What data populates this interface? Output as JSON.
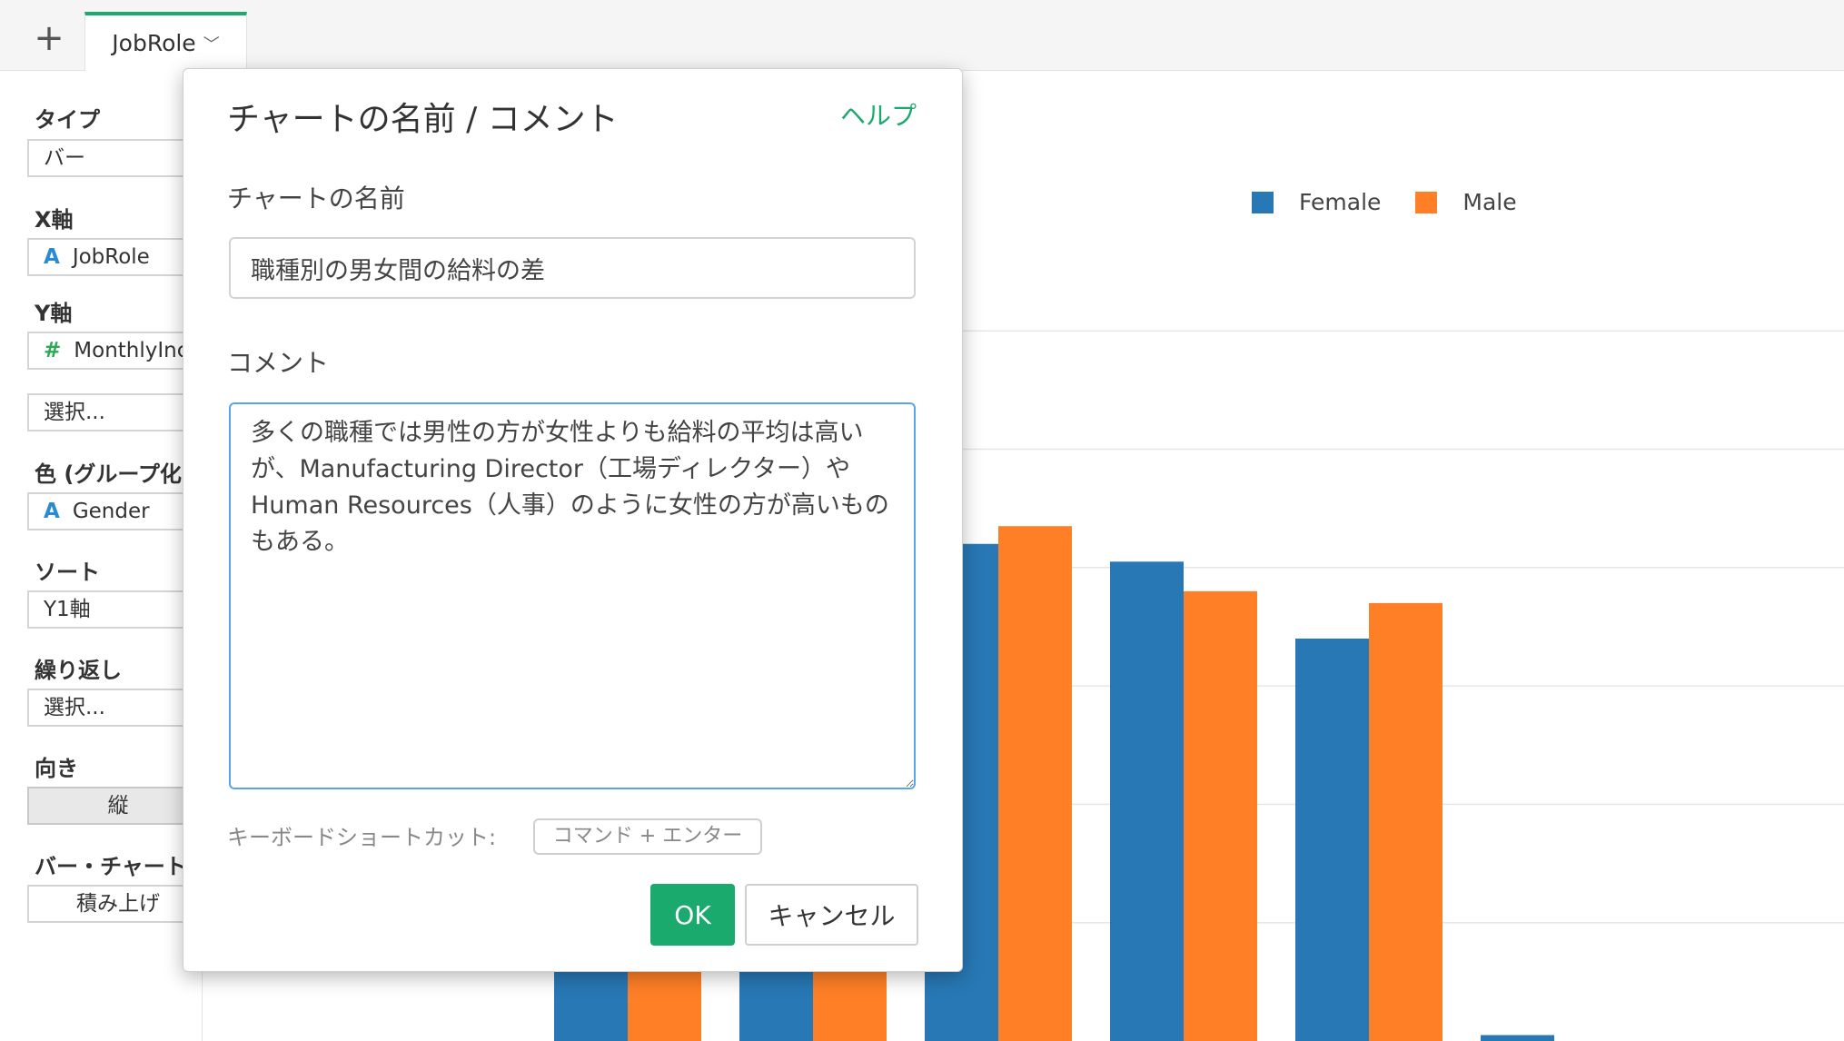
{
  "tabs": {
    "add_symbol": "+",
    "active_tab": "JobRole",
    "chevron": "﹀"
  },
  "config": {
    "type_label": "タイプ",
    "type_value": "バー",
    "x_label": "X軸",
    "x_icon": "A",
    "x_value": "JobRole",
    "y_label": "Y軸",
    "y_icon": "#",
    "y_value": "MonthlyInc",
    "select_placeholder": "選択...",
    "color_label": "色 (グループ化)",
    "color_icon": "A",
    "color_value": "Gender",
    "sort_label": "ソート",
    "sort_value": "Y1軸",
    "repeat_label": "繰り返し",
    "repeat_value": "選択...",
    "orientation_label": "向き",
    "orientation_value": "縦",
    "bar_chart_label": "バー・チャート",
    "bar_chart_value": "積み上げ"
  },
  "dialog": {
    "title": "チャートの名前 / コメント",
    "help": "ヘルプ",
    "name_label": "チャートの名前",
    "name_value": "職種別の男女間の給料の差",
    "comment_label": "コメント",
    "comment_value": "多くの職種では男性の方が女性よりも給料の平均は高いが、Manufacturing Director（工場ディレクター）やHuman Resources（人事）のように女性の方が高いものもある。",
    "shortcut_label": "キーボードショートカット:",
    "shortcut_button": "コマンド + エンター",
    "ok": "OK",
    "cancel": "キャンセル"
  },
  "chart_data": {
    "type": "bar",
    "series": [
      {
        "name": "Female",
        "color": "#2878b5",
        "values": [
          4.2,
          4.2,
          4.2,
          4.05,
          3.4,
          0.05
        ]
      },
      {
        "name": "Male",
        "color": "#ff7f27",
        "values": [
          1.5,
          1.5,
          4.35,
          3.8,
          3.7,
          0
        ]
      }
    ],
    "ylim": [
      0,
      6.7
    ],
    "grid": true,
    "legend_position": "top"
  }
}
